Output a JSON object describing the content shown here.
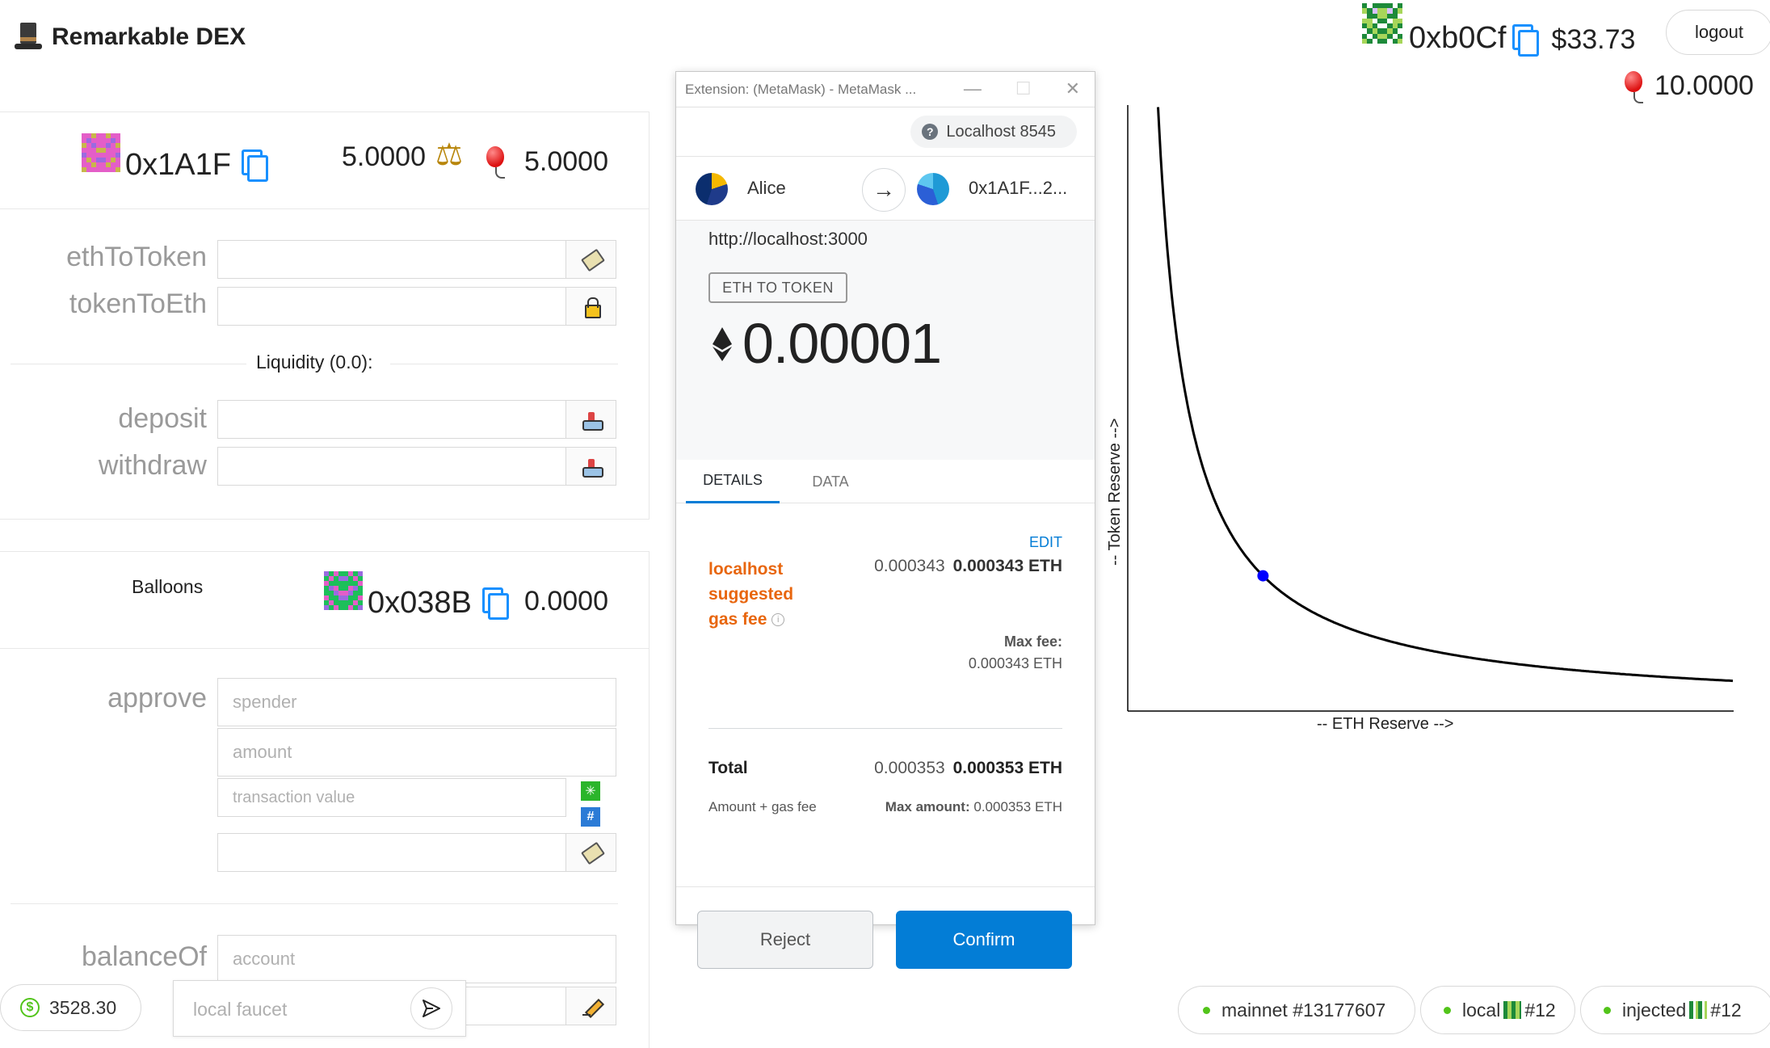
{
  "app": {
    "title": "Remarkable DEX"
  },
  "header": {
    "address": "0xb0Cf",
    "usd_balance": "$33.73",
    "token_balance": "10.0000",
    "logout_label": "logout"
  },
  "dex": {
    "address": "0x1A1F",
    "eth_balance": "5.0000",
    "token_balance": "5.0000",
    "rows": [
      {
        "label": "ethToToken"
      },
      {
        "label": "tokenToEth"
      }
    ],
    "liquidity_label": "Liquidity (0.0):",
    "liquidity_rows": [
      {
        "label": "deposit"
      },
      {
        "label": "withdraw"
      }
    ]
  },
  "token": {
    "name": "Balloons",
    "address": "0x038B",
    "balance": "0.0000",
    "approve_label": "approve",
    "spender_placeholder": "spender",
    "amount_placeholder": "amount",
    "txvalue_placeholder": "transaction value",
    "balanceof_label": "balanceOf",
    "account_placeholder": "account"
  },
  "faucet": {
    "balance": "3528.30",
    "placeholder": "local faucet"
  },
  "metamask": {
    "window_title": "Extension: (MetaMask) - MetaMask ...",
    "network": "Localhost 8545",
    "from_account": "Alice",
    "to_account": "0x1A1F...2...",
    "origin": "http://localhost:3000",
    "method": "ETH TO TOKEN",
    "amount": "0.00001",
    "tabs": [
      "DETAILS",
      "DATA"
    ],
    "edit_label": "EDIT",
    "gas_label": "localhost suggested gas fee",
    "gas_value_light": "0.000343",
    "gas_value_bold": "0.000343 ETH",
    "max_fee_label": "Max fee:",
    "max_fee_value": "0.000343 ETH",
    "total_label": "Total",
    "total_value_light": "0.000353",
    "total_value_bold": "0.000353 ETH",
    "amount_gas_label": "Amount + gas fee",
    "max_amount_label": "Max amount:",
    "max_amount_value": "0.000353 ETH",
    "reject_label": "Reject",
    "confirm_label": "Confirm"
  },
  "chart_data": {
    "type": "line",
    "title": "",
    "xlabel": "-- ETH Reserve -->",
    "ylabel": "-- Token Reserve -->",
    "curve": "x * y = k",
    "point": {
      "x": 5,
      "y": 5
    },
    "series": [
      {
        "x": [
          1.12,
          1.5,
          2,
          3,
          4,
          5,
          6,
          8,
          10,
          12,
          15,
          18,
          20,
          22.4
        ],
        "y": [
          22.4,
          16.7,
          12.5,
          8.33,
          6.25,
          5.0,
          4.17,
          3.13,
          2.5,
          2.08,
          1.67,
          1.39,
          1.25,
          1.12
        ]
      }
    ],
    "colors": {
      "line": "#000000",
      "point": "#0000ff"
    }
  },
  "networks": [
    {
      "label": "mainnet #13177607"
    },
    {
      "label": "local",
      "suffix": "#12"
    },
    {
      "label": "injected",
      "suffix": "#12"
    }
  ]
}
